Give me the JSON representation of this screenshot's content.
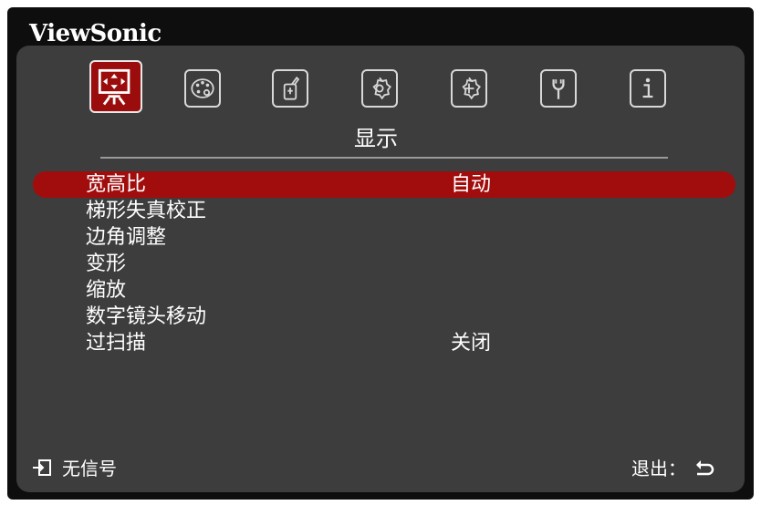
{
  "brand": "ViewSonic",
  "tabs": [
    {
      "icon": "display-icon",
      "active": true
    },
    {
      "icon": "picture-palette-icon",
      "active": false
    },
    {
      "icon": "power-management-icon",
      "active": false
    },
    {
      "icon": "basic-settings-icon",
      "active": false
    },
    {
      "icon": "advanced-settings-icon",
      "active": false
    },
    {
      "icon": "system-wrench-icon",
      "active": false
    },
    {
      "icon": "information-icon",
      "active": false
    }
  ],
  "section_title": "显示",
  "menu": [
    {
      "label": "宽高比",
      "value": "自动",
      "selected": true
    },
    {
      "label": "梯形失真校正",
      "value": ""
    },
    {
      "label": "边角调整",
      "value": ""
    },
    {
      "label": "变形",
      "value": ""
    },
    {
      "label": "缩放",
      "value": ""
    },
    {
      "label": "数字镜头移动",
      "value": ""
    },
    {
      "label": "过扫描",
      "value": "关闭"
    }
  ],
  "footer": {
    "source_status": "无信号",
    "exit_label": "退出："
  },
  "colors": {
    "accent": "#a10d0d",
    "panel": "#3d3d3d",
    "frame": "#0e0e0e"
  }
}
